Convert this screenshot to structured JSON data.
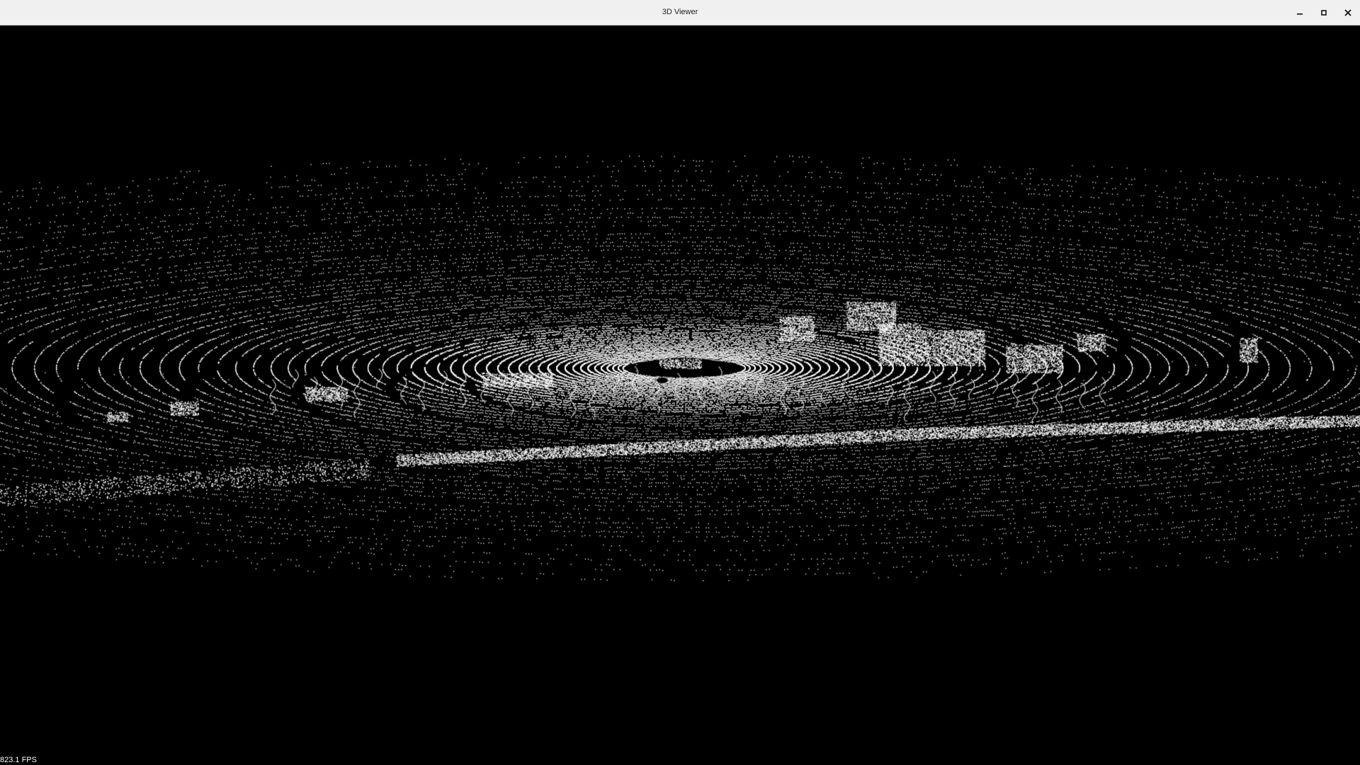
{
  "window": {
    "title": "3D Viewer"
  },
  "controls": {
    "minimize_icon": "minimize-icon",
    "maximize_icon": "maximize-icon",
    "close_icon": "close-icon"
  },
  "viewport": {
    "background": "#000000",
    "point_color": "#ffffff"
  },
  "status": {
    "fps": "823.1 FPS"
  }
}
